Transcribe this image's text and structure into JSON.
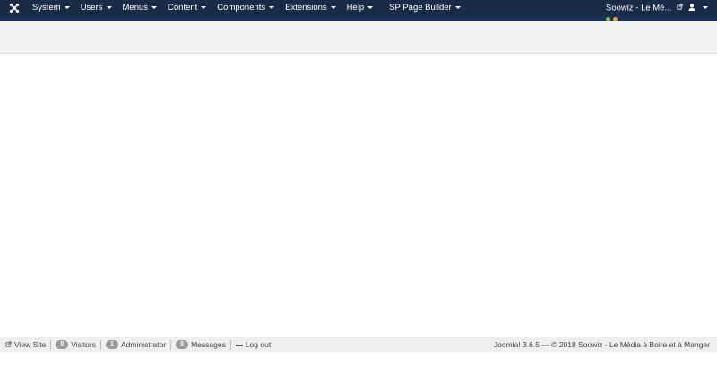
{
  "navbar": {
    "logo_icon": "joomla-logo-icon",
    "menu": [
      {
        "label": "System"
      },
      {
        "label": "Users"
      },
      {
        "label": "Menus"
      },
      {
        "label": "Content"
      },
      {
        "label": "Components"
      },
      {
        "label": "Extensions"
      },
      {
        "label": "Help"
      },
      {
        "label": "SP Page Builder"
      }
    ],
    "site_name": "Soowiz - Le Mé...",
    "colors": {
      "background": "#1a2b48",
      "band": "#1c2f54",
      "dot_green": "#7ac142",
      "dot_orange": "#f0a030"
    }
  },
  "statusbar": {
    "view_site": "View Site",
    "visitors_count": "0",
    "visitors_label": "Visitors",
    "admin_count": "1",
    "admin_label": "Administrator",
    "messages_count": "0",
    "messages_label": "Messages",
    "logout_label": "Log out",
    "version_text": "Joomla! 3.6.5  —  © 2018 Soowiz - Le Média à Boire et à Manger"
  }
}
